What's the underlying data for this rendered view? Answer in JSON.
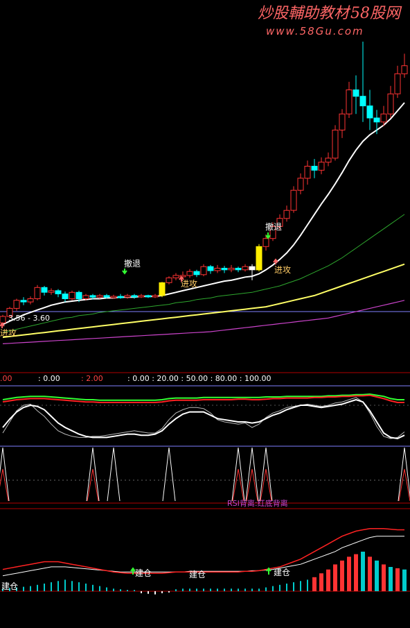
{
  "watermark": {
    "title": "炒股輔助教材",
    "brand": "58股网",
    "url": "www.58Gu.com"
  },
  "colors": {
    "bg": "#000000",
    "up": "#ff3333",
    "down": "#00ffff",
    "yellow_candle": "#ffee00",
    "ma_white": "#ffffff",
    "ma_green": "#2ea82e",
    "ma_yellow": "#ffff66",
    "ma_magenta": "#cc44cc",
    "grid": "#8080ff",
    "panel_border": "#b00000"
  },
  "price_panel": {
    "range_label": "3.56 - 3.60"
  },
  "signals": [
    {
      "text": "进攻",
      "color": "#ffcc66"
    },
    {
      "text": "撤退",
      "color": "#ffffff"
    },
    {
      "text": "进攻",
      "color": "#ffcc66"
    },
    {
      "text": "撤退",
      "color": "#ffffff"
    },
    {
      "text": "进攻",
      "color": "#ffcc66"
    }
  ],
  "indicator_header": {
    "items": [
      {
        "text": ".00",
        "color": "#ff4444"
      },
      {
        "text": ": 0.00",
        "color": "#ffffff"
      },
      {
        "text": ": 2.00",
        "color": "#ff4444"
      },
      {
        "text": ": 0.00 : 20.00 : 50.00 : 80.00 : 100.00",
        "color": "#ffffff"
      }
    ]
  },
  "spike_panel": {
    "overlay_text": "RSI背离:红底背离"
  },
  "volume_panel": {
    "labels": [
      "建仓",
      "建仓",
      "建仓",
      "建仓"
    ]
  },
  "chart_data": {
    "type": "candlestick",
    "candles": [
      [
        3.4,
        3.48,
        3.38,
        3.5
      ],
      [
        3.48,
        3.58,
        3.46,
        3.6
      ],
      [
        3.58,
        3.68,
        3.55,
        3.7
      ],
      [
        3.68,
        3.66,
        3.62,
        3.72
      ],
      [
        3.66,
        3.7,
        3.63,
        3.73
      ],
      [
        3.7,
        3.84,
        3.68,
        3.87
      ],
      [
        3.84,
        3.78,
        3.74,
        3.86
      ],
      [
        3.78,
        3.8,
        3.75,
        3.83
      ],
      [
        3.8,
        3.76,
        3.72,
        3.82
      ],
      [
        3.76,
        3.7,
        3.66,
        3.79
      ],
      [
        3.7,
        3.78,
        3.68,
        3.8
      ],
      [
        3.78,
        3.7,
        3.66,
        3.8
      ],
      [
        3.7,
        3.74,
        3.68,
        3.76
      ],
      [
        3.74,
        3.72,
        3.69,
        3.76
      ],
      [
        3.72,
        3.74,
        3.7,
        3.76
      ],
      [
        3.74,
        3.72,
        3.7,
        3.76
      ],
      [
        3.72,
        3.73,
        3.7,
        3.75
      ],
      [
        3.73,
        3.72,
        3.7,
        3.76
      ],
      [
        3.72,
        3.74,
        3.7,
        3.76
      ],
      [
        3.74,
        3.73,
        3.7,
        3.76
      ],
      [
        3.73,
        3.74,
        3.71,
        3.76
      ],
      [
        3.74,
        3.73,
        3.71,
        3.75
      ],
      [
        3.73,
        3.74,
        3.71,
        3.76
      ],
      [
        3.74,
        3.9,
        3.72,
        3.91
      ],
      [
        3.9,
        3.96,
        3.88,
        3.98
      ],
      [
        3.96,
        3.99,
        3.93,
        4.02
      ],
      [
        3.99,
        3.99,
        3.95,
        4.04
      ],
      [
        3.99,
        4.04,
        3.96,
        4.07
      ],
      [
        4.04,
        4.0,
        3.97,
        4.06
      ],
      [
        4.0,
        4.1,
        3.98,
        4.13
      ],
      [
        4.1,
        4.05,
        4.01,
        4.12
      ],
      [
        4.05,
        4.08,
        4.02,
        4.12
      ],
      [
        4.08,
        4.06,
        4.02,
        4.11
      ],
      [
        4.06,
        4.08,
        4.03,
        4.12
      ],
      [
        4.08,
        4.06,
        4.03,
        4.1
      ],
      [
        4.06,
        4.1,
        4.04,
        4.13
      ],
      [
        4.1,
        4.06,
        3.93,
        4.13
      ],
      [
        4.06,
        4.35,
        4.04,
        4.38
      ],
      [
        4.35,
        4.45,
        4.3,
        4.5
      ],
      [
        4.45,
        4.6,
        4.42,
        4.65
      ],
      [
        4.6,
        4.7,
        4.55,
        4.75
      ],
      [
        4.7,
        4.8,
        4.66,
        4.86
      ],
      [
        4.8,
        5.05,
        4.77,
        5.1
      ],
      [
        5.05,
        5.2,
        5.0,
        5.26
      ],
      [
        5.2,
        5.35,
        5.12,
        5.42
      ],
      [
        5.35,
        5.3,
        5.2,
        5.44
      ],
      [
        5.3,
        5.4,
        5.25,
        5.46
      ],
      [
        5.4,
        5.45,
        5.35,
        5.52
      ],
      [
        5.45,
        5.8,
        5.42,
        5.86
      ],
      [
        5.8,
        6.0,
        5.7,
        6.06
      ],
      [
        6.0,
        6.3,
        5.95,
        6.4
      ],
      [
        6.3,
        6.22,
        6.0,
        6.48
      ],
      [
        6.22,
        6.1,
        5.9,
        6.9
      ],
      [
        6.1,
        5.95,
        5.8,
        6.3
      ],
      [
        5.95,
        5.9,
        5.75,
        6.05
      ],
      [
        5.9,
        6.0,
        5.85,
        6.1
      ],
      [
        6.0,
        6.25,
        5.95,
        6.35
      ],
      [
        6.25,
        6.5,
        6.2,
        6.6
      ],
      [
        6.5,
        6.6,
        6.45,
        6.75
      ]
    ],
    "special_candles": {
      "yellow": [
        23,
        37
      ],
      "white": [
        36
      ]
    },
    "ma_white": [
      3.38,
      3.42,
      3.46,
      3.5,
      3.53,
      3.56,
      3.59,
      3.62,
      3.64,
      3.66,
      3.67,
      3.68,
      3.69,
      3.7,
      3.7,
      3.71,
      3.71,
      3.72,
      3.72,
      3.72,
      3.73,
      3.73,
      3.73,
      3.74,
      3.76,
      3.78,
      3.8,
      3.82,
      3.84,
      3.86,
      3.88,
      3.9,
      3.92,
      3.93,
      3.95,
      3.97,
      3.98,
      4.01,
      4.06,
      4.12,
      4.19,
      4.27,
      4.37,
      4.49,
      4.62,
      4.75,
      4.88,
      5.0,
      5.13,
      5.27,
      5.42,
      5.55,
      5.66,
      5.74,
      5.8,
      5.86,
      5.94,
      6.04,
      6.14
    ],
    "ma_green": [
      3.28,
      3.3,
      3.32,
      3.34,
      3.36,
      3.38,
      3.4,
      3.42,
      3.44,
      3.46,
      3.47,
      3.49,
      3.5,
      3.51,
      3.53,
      3.54,
      3.55,
      3.56,
      3.57,
      3.58,
      3.59,
      3.6,
      3.61,
      3.62,
      3.63,
      3.65,
      3.66,
      3.67,
      3.69,
      3.7,
      3.71,
      3.73,
      3.74,
      3.75,
      3.76,
      3.77,
      3.78,
      3.8,
      3.82,
      3.84,
      3.86,
      3.89,
      3.92,
      3.95,
      3.99,
      4.03,
      4.07,
      4.11,
      4.16,
      4.21,
      4.27,
      4.33,
      4.39,
      4.45,
      4.51,
      4.57,
      4.63,
      4.69,
      4.75
    ],
    "ma_yellow": [
      3.22,
      3.23,
      3.24,
      3.25,
      3.26,
      3.27,
      3.28,
      3.29,
      3.3,
      3.31,
      3.32,
      3.33,
      3.34,
      3.35,
      3.36,
      3.37,
      3.38,
      3.39,
      3.4,
      3.41,
      3.42,
      3.43,
      3.44,
      3.45,
      3.46,
      3.47,
      3.48,
      3.49,
      3.5,
      3.51,
      3.52,
      3.53,
      3.54,
      3.55,
      3.56,
      3.57,
      3.58,
      3.59,
      3.6,
      3.62,
      3.64,
      3.66,
      3.68,
      3.7,
      3.72,
      3.74,
      3.77,
      3.8,
      3.83,
      3.86,
      3.89,
      3.92,
      3.95,
      3.98,
      4.01,
      4.04,
      4.07,
      4.1,
      4.13
    ],
    "ma_magenta": [
      3.14,
      3.145,
      3.15,
      3.155,
      3.16,
      3.165,
      3.17,
      3.175,
      3.18,
      3.185,
      3.19,
      3.195,
      3.2,
      3.205,
      3.21,
      3.215,
      3.22,
      3.225,
      3.23,
      3.235,
      3.24,
      3.245,
      3.25,
      3.255,
      3.26,
      3.265,
      3.27,
      3.275,
      3.28,
      3.285,
      3.29,
      3.3,
      3.31,
      3.32,
      3.33,
      3.34,
      3.35,
      3.36,
      3.37,
      3.38,
      3.39,
      3.4,
      3.41,
      3.42,
      3.43,
      3.44,
      3.45,
      3.46,
      3.48,
      3.5,
      3.52,
      3.54,
      3.56,
      3.58,
      3.6,
      3.62,
      3.64,
      3.66,
      3.68
    ],
    "price_ylim": [
      3.1,
      6.9
    ],
    "osc": {
      "ylim": [
        0,
        100
      ],
      "green": [
        80,
        82,
        84,
        85,
        86,
        86,
        86,
        85,
        84,
        83,
        82,
        81,
        80,
        80,
        79,
        79,
        79,
        79,
        79,
        79,
        79,
        79,
        79,
        80,
        82,
        83,
        83,
        83,
        83,
        84,
        84,
        84,
        84,
        84,
        84,
        84,
        84,
        84,
        85,
        85,
        85,
        86,
        86,
        86,
        86,
        86,
        86,
        87,
        87,
        88,
        88,
        89,
        89,
        90,
        88,
        86,
        82,
        80,
        80
      ],
      "red": [
        76,
        78,
        80,
        81,
        82,
        82,
        82,
        81,
        80,
        79,
        78,
        77,
        76,
        76,
        75,
        75,
        75,
        75,
        75,
        75,
        75,
        75,
        75,
        76,
        78,
        79,
        79,
        79,
        79,
        80,
        80,
        80,
        80,
        80,
        81,
        81,
        80,
        80,
        81,
        82,
        82,
        83,
        83,
        83,
        83,
        84,
        84,
        85,
        85,
        86,
        86,
        87,
        87,
        88,
        85,
        82,
        78,
        75,
        75
      ],
      "white": [
        30,
        45,
        58,
        66,
        70,
        68,
        62,
        50,
        38,
        30,
        24,
        18,
        14,
        12,
        12,
        12,
        14,
        16,
        18,
        18,
        16,
        16,
        18,
        24,
        36,
        46,
        54,
        58,
        58,
        58,
        52,
        46,
        44,
        42,
        40,
        40,
        38,
        40,
        46,
        52,
        56,
        62,
        66,
        70,
        70,
        68,
        66,
        68,
        70,
        72,
        76,
        80,
        76,
        60,
        40,
        20,
        12,
        10,
        16
      ],
      "thin_white": [
        20,
        40,
        60,
        70,
        72,
        60,
        50,
        36,
        24,
        18,
        14,
        12,
        12,
        14,
        14,
        16,
        18,
        20,
        22,
        24,
        22,
        20,
        20,
        28,
        44,
        56,
        62,
        66,
        66,
        64,
        56,
        44,
        40,
        38,
        36,
        38,
        30,
        36,
        48,
        56,
        60,
        66,
        68,
        70,
        72,
        70,
        68,
        70,
        74,
        76,
        80,
        84,
        76,
        56,
        32,
        14,
        10,
        12,
        22
      ]
    },
    "spikes": {
      "ylim": [
        0,
        100
      ],
      "white_at": [
        0,
        13,
        16,
        24,
        34,
        36,
        38,
        58
      ],
      "red_at": [
        0,
        13,
        34,
        36,
        38,
        58
      ]
    },
    "volume": {
      "ylim": [
        0,
        100
      ],
      "bars": [
        4,
        5,
        6,
        7,
        8,
        10,
        12,
        14,
        16,
        18,
        16,
        14,
        12,
        10,
        8,
        6,
        4,
        3,
        2,
        2,
        -3,
        -4,
        -5,
        -3,
        -2,
        3,
        4,
        4,
        4,
        4,
        4,
        4,
        4,
        4,
        4,
        4,
        4,
        4,
        6,
        8,
        10,
        12,
        14,
        16,
        18,
        22,
        28,
        34,
        42,
        48,
        54,
        58,
        62,
        54,
        48,
        42,
        38,
        36,
        34
      ],
      "red_line": [
        32,
        34,
        36,
        38,
        40,
        42,
        44,
        44,
        44,
        42,
        40,
        38,
        36,
        34,
        32,
        30,
        28,
        27,
        26,
        26,
        26,
        26,
        26,
        26,
        27,
        28,
        28,
        28,
        28,
        28,
        28,
        28,
        28,
        28,
        28,
        29,
        29,
        30,
        32,
        34,
        36,
        40,
        44,
        48,
        54,
        60,
        66,
        72,
        78,
        84,
        88,
        92,
        94,
        96,
        96,
        96,
        95,
        94,
        94
      ],
      "white_line": [
        22,
        24,
        26,
        28,
        30,
        32,
        34,
        36,
        36,
        36,
        35,
        34,
        33,
        32,
        31,
        30,
        29,
        28,
        28,
        28,
        28,
        28,
        28,
        28,
        28,
        28,
        28,
        29,
        29,
        29,
        29,
        29,
        29,
        29,
        29,
        29,
        30,
        30,
        31,
        32,
        34,
        36,
        38,
        40,
        44,
        48,
        52,
        56,
        60,
        66,
        70,
        74,
        78,
        82,
        84,
        84,
        84,
        84,
        84
      ]
    }
  }
}
